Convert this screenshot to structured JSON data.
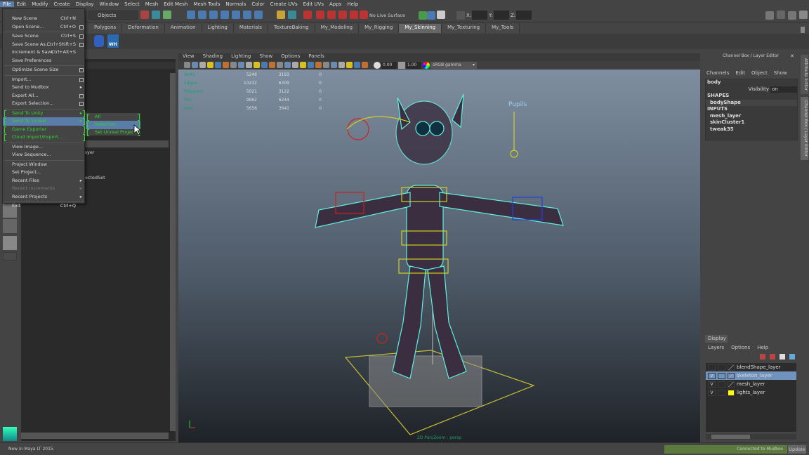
{
  "menubar": [
    "File",
    "Edit",
    "Modify",
    "Create",
    "Display",
    "Window",
    "Select",
    "Mesh",
    "Edit Mesh",
    "Mesh Tools",
    "Normals",
    "Color",
    "Create UVs",
    "Edit UVs",
    "Apps",
    "Help"
  ],
  "status": {
    "selection_mode": "Objects",
    "live_surface": "No Live Surface",
    "x_label": "X:",
    "y_label": "Y:",
    "z_label": "Z:"
  },
  "shelf_tabs": [
    "Polygons",
    "Deformation",
    "Animation",
    "Lighting",
    "Materials",
    "TextureBaking",
    "My_Modeling",
    "My_Rigging",
    "My_Skinning",
    "My_Texturing",
    "My_Tools"
  ],
  "shelf_active": "My_Skinning",
  "shelf_icon_label": "WH",
  "file_menu": [
    {
      "label": "New Scene",
      "shortcut": "Ctrl+N"
    },
    {
      "label": "Open Scene...",
      "shortcut": "Ctrl+O",
      "option": true
    },
    {
      "label": "Save Scene",
      "shortcut": "Ctrl+S",
      "option": true
    },
    {
      "label": "Save Scene As...",
      "shortcut": "Ctrl+Shift+S",
      "option": true
    },
    {
      "label": "Increment & Save",
      "shortcut": "Ctrl+Alt+S"
    },
    {
      "label": "Save Preferences"
    },
    {
      "label": "Optimize Scene Size",
      "option": true
    },
    {
      "label": "Import...",
      "option": true
    },
    {
      "label": "Send to Mudbox",
      "submenu": true
    },
    {
      "label": "Export All...",
      "option": true
    },
    {
      "label": "Export Selection...",
      "option": true
    },
    {
      "label": "Send To Unity",
      "submenu": true,
      "custom": true
    },
    {
      "label": "Send To Unreal",
      "submenu": true,
      "custom": true,
      "highlighted": true
    },
    {
      "label": "Game Exporter",
      "custom": true
    },
    {
      "label": "Cloud Import/Export...",
      "custom": true
    },
    {
      "label": "View Image..."
    },
    {
      "label": "View Sequence..."
    },
    {
      "label": "Project Window"
    },
    {
      "label": "Set Project..."
    },
    {
      "label": "Recent Files",
      "submenu": true
    },
    {
      "label": "Recent Increments",
      "submenu": true,
      "disabled": true
    },
    {
      "label": "Recent Projects",
      "submenu": true
    },
    {
      "label": "Exit",
      "shortcut": "Ctrl+Q"
    }
  ],
  "unreal_submenu": [
    {
      "label": "All"
    },
    {
      "label": "Selection",
      "highlighted": true
    },
    {
      "label": "Set Unreal Project"
    }
  ],
  "outliner": {
    "partial_items": [
      "ayer",
      "electedSet"
    ]
  },
  "viewport": {
    "menu": [
      "View",
      "Shading",
      "Lighting",
      "Show",
      "Options",
      "Panels"
    ],
    "exposure": "0.00",
    "gamma": "1.00",
    "color_space": "sRGB gamma",
    "hud": [
      {
        "label": "Verts:",
        "a": "5246",
        "b": "3193",
        "c": "0"
      },
      {
        "label": "Edges:",
        "a": "10232",
        "b": "6309",
        "c": "0"
      },
      {
        "label": "Polygons:",
        "a": "5021",
        "b": "3122",
        "c": "0"
      },
      {
        "label": "Tris:",
        "a": "9962",
        "b": "6244",
        "c": "0"
      },
      {
        "label": "UVs:",
        "a": "5656",
        "b": "3641",
        "c": "0"
      }
    ],
    "annotation": "Pupils",
    "camera_label": "2D Pan/Zoom : persp"
  },
  "channel_box": {
    "title": "Channel Box / Layer Editor",
    "menu": [
      "Channels",
      "Edit",
      "Object",
      "Show"
    ],
    "object": "body",
    "visibility_label": "Visibility",
    "visibility_value": "on",
    "shapes_header": "SHAPES",
    "shapes": [
      "bodyShape"
    ],
    "inputs_header": "INPUTS",
    "inputs": [
      "mesh_layer",
      "skinCluster1",
      "tweak35"
    ]
  },
  "side_tabs": [
    "Attribute Editor",
    "Channel Box / Layer Editor"
  ],
  "layer_editor": {
    "tab": "Display",
    "menu": [
      "Layers",
      "Options",
      "Help"
    ],
    "layers": [
      {
        "name": "blendShape_layer",
        "visible": "",
        "selected": false,
        "color": ""
      },
      {
        "name": "skeleton_layer",
        "visible": "V",
        "selected": true,
        "color": ""
      },
      {
        "name": "mesh_layer",
        "visible": "V",
        "selected": false,
        "color": ""
      },
      {
        "name": "lights_layer",
        "visible": "V",
        "selected": false,
        "color": "#ffff00"
      }
    ]
  },
  "help_line": "New in Maya LT 2015.",
  "mudbox": {
    "status": "Connected to Mudbox",
    "button": "Update"
  },
  "colors": {
    "accent": "#5a7ca8",
    "custom_menu": "#2fd82f",
    "hud_label": "#19a06a",
    "wireframe": "#5ff0e0",
    "mudbox_bar": "#5c7a3c"
  }
}
